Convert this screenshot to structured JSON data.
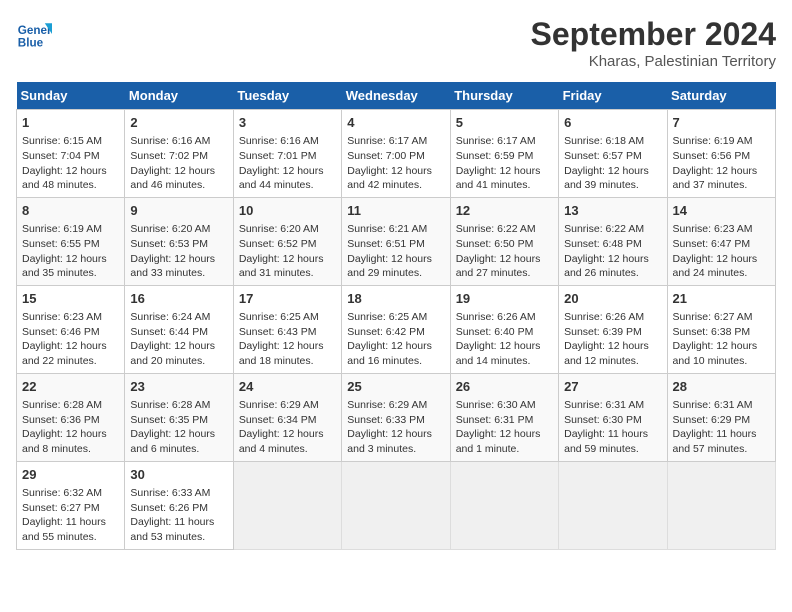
{
  "header": {
    "logo_line1": "General",
    "logo_line2": "Blue",
    "month": "September 2024",
    "location": "Kharas, Palestinian Territory"
  },
  "columns": [
    "Sunday",
    "Monday",
    "Tuesday",
    "Wednesday",
    "Thursday",
    "Friday",
    "Saturday"
  ],
  "weeks": [
    [
      {
        "day": "1",
        "lines": [
          "Sunrise: 6:15 AM",
          "Sunset: 7:04 PM",
          "Daylight: 12 hours",
          "and 48 minutes."
        ]
      },
      {
        "day": "2",
        "lines": [
          "Sunrise: 6:16 AM",
          "Sunset: 7:02 PM",
          "Daylight: 12 hours",
          "and 46 minutes."
        ]
      },
      {
        "day": "3",
        "lines": [
          "Sunrise: 6:16 AM",
          "Sunset: 7:01 PM",
          "Daylight: 12 hours",
          "and 44 minutes."
        ]
      },
      {
        "day": "4",
        "lines": [
          "Sunrise: 6:17 AM",
          "Sunset: 7:00 PM",
          "Daylight: 12 hours",
          "and 42 minutes."
        ]
      },
      {
        "day": "5",
        "lines": [
          "Sunrise: 6:17 AM",
          "Sunset: 6:59 PM",
          "Daylight: 12 hours",
          "and 41 minutes."
        ]
      },
      {
        "day": "6",
        "lines": [
          "Sunrise: 6:18 AM",
          "Sunset: 6:57 PM",
          "Daylight: 12 hours",
          "and 39 minutes."
        ]
      },
      {
        "day": "7",
        "lines": [
          "Sunrise: 6:19 AM",
          "Sunset: 6:56 PM",
          "Daylight: 12 hours",
          "and 37 minutes."
        ]
      }
    ],
    [
      {
        "day": "8",
        "lines": [
          "Sunrise: 6:19 AM",
          "Sunset: 6:55 PM",
          "Daylight: 12 hours",
          "and 35 minutes."
        ]
      },
      {
        "day": "9",
        "lines": [
          "Sunrise: 6:20 AM",
          "Sunset: 6:53 PM",
          "Daylight: 12 hours",
          "and 33 minutes."
        ]
      },
      {
        "day": "10",
        "lines": [
          "Sunrise: 6:20 AM",
          "Sunset: 6:52 PM",
          "Daylight: 12 hours",
          "and 31 minutes."
        ]
      },
      {
        "day": "11",
        "lines": [
          "Sunrise: 6:21 AM",
          "Sunset: 6:51 PM",
          "Daylight: 12 hours",
          "and 29 minutes."
        ]
      },
      {
        "day": "12",
        "lines": [
          "Sunrise: 6:22 AM",
          "Sunset: 6:50 PM",
          "Daylight: 12 hours",
          "and 27 minutes."
        ]
      },
      {
        "day": "13",
        "lines": [
          "Sunrise: 6:22 AM",
          "Sunset: 6:48 PM",
          "Daylight: 12 hours",
          "and 26 minutes."
        ]
      },
      {
        "day": "14",
        "lines": [
          "Sunrise: 6:23 AM",
          "Sunset: 6:47 PM",
          "Daylight: 12 hours",
          "and 24 minutes."
        ]
      }
    ],
    [
      {
        "day": "15",
        "lines": [
          "Sunrise: 6:23 AM",
          "Sunset: 6:46 PM",
          "Daylight: 12 hours",
          "and 22 minutes."
        ]
      },
      {
        "day": "16",
        "lines": [
          "Sunrise: 6:24 AM",
          "Sunset: 6:44 PM",
          "Daylight: 12 hours",
          "and 20 minutes."
        ]
      },
      {
        "day": "17",
        "lines": [
          "Sunrise: 6:25 AM",
          "Sunset: 6:43 PM",
          "Daylight: 12 hours",
          "and 18 minutes."
        ]
      },
      {
        "day": "18",
        "lines": [
          "Sunrise: 6:25 AM",
          "Sunset: 6:42 PM",
          "Daylight: 12 hours",
          "and 16 minutes."
        ]
      },
      {
        "day": "19",
        "lines": [
          "Sunrise: 6:26 AM",
          "Sunset: 6:40 PM",
          "Daylight: 12 hours",
          "and 14 minutes."
        ]
      },
      {
        "day": "20",
        "lines": [
          "Sunrise: 6:26 AM",
          "Sunset: 6:39 PM",
          "Daylight: 12 hours",
          "and 12 minutes."
        ]
      },
      {
        "day": "21",
        "lines": [
          "Sunrise: 6:27 AM",
          "Sunset: 6:38 PM",
          "Daylight: 12 hours",
          "and 10 minutes."
        ]
      }
    ],
    [
      {
        "day": "22",
        "lines": [
          "Sunrise: 6:28 AM",
          "Sunset: 6:36 PM",
          "Daylight: 12 hours",
          "and 8 minutes."
        ]
      },
      {
        "day": "23",
        "lines": [
          "Sunrise: 6:28 AM",
          "Sunset: 6:35 PM",
          "Daylight: 12 hours",
          "and 6 minutes."
        ]
      },
      {
        "day": "24",
        "lines": [
          "Sunrise: 6:29 AM",
          "Sunset: 6:34 PM",
          "Daylight: 12 hours",
          "and 4 minutes."
        ]
      },
      {
        "day": "25",
        "lines": [
          "Sunrise: 6:29 AM",
          "Sunset: 6:33 PM",
          "Daylight: 12 hours",
          "and 3 minutes."
        ]
      },
      {
        "day": "26",
        "lines": [
          "Sunrise: 6:30 AM",
          "Sunset: 6:31 PM",
          "Daylight: 12 hours",
          "and 1 minute."
        ]
      },
      {
        "day": "27",
        "lines": [
          "Sunrise: 6:31 AM",
          "Sunset: 6:30 PM",
          "Daylight: 11 hours",
          "and 59 minutes."
        ]
      },
      {
        "day": "28",
        "lines": [
          "Sunrise: 6:31 AM",
          "Sunset: 6:29 PM",
          "Daylight: 11 hours",
          "and 57 minutes."
        ]
      }
    ],
    [
      {
        "day": "29",
        "lines": [
          "Sunrise: 6:32 AM",
          "Sunset: 6:27 PM",
          "Daylight: 11 hours",
          "and 55 minutes."
        ]
      },
      {
        "day": "30",
        "lines": [
          "Sunrise: 6:33 AM",
          "Sunset: 6:26 PM",
          "Daylight: 11 hours",
          "and 53 minutes."
        ]
      },
      null,
      null,
      null,
      null,
      null
    ]
  ]
}
